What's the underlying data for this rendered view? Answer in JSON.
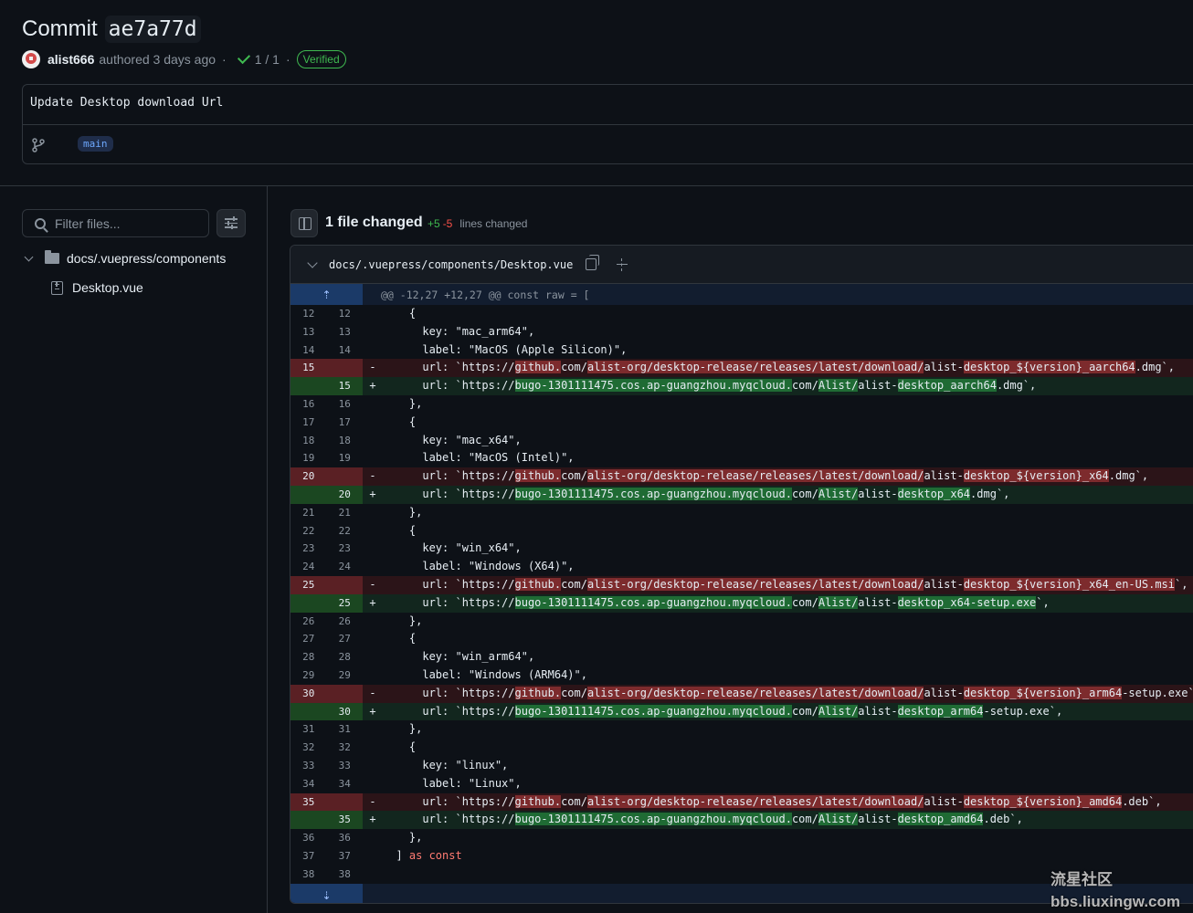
{
  "commit": {
    "word": "Commit",
    "sha": "ae7a77d",
    "author": "alist666",
    "authored": "authored 3 days ago",
    "sep": "·",
    "checks": "1 / 1",
    "verified": "Verified",
    "message": "Update Desktop download Url",
    "branch": "main"
  },
  "sidebar": {
    "filter_placeholder": "Filter files...",
    "folder": "docs/.vuepress/components",
    "file": "Desktop.vue"
  },
  "summary": {
    "files_changed": "1 file changed",
    "additions": "+5",
    "deletions": "-5",
    "lines_changed": "lines changed"
  },
  "file_header": {
    "path": "docs/.vuepress/components/Desktop.vue"
  },
  "hunk_header": "@@ -12,27 +12,27 @@ const raw = [",
  "diff_lines": [
    {
      "type": "ctx",
      "old": "12",
      "new": "12",
      "code": "    {"
    },
    {
      "type": "ctx",
      "old": "13",
      "new": "13",
      "code": "      key: \"mac_arm64\","
    },
    {
      "type": "ctx",
      "old": "14",
      "new": "14",
      "code": "      label: \"MacOS (Apple Silicon)\","
    },
    {
      "type": "del",
      "old": "15",
      "new": "",
      "parts": [
        "      url: `https://",
        "!github.",
        "com/",
        "!alist-org/desktop-release/releases/latest/download/",
        "alist-",
        "!desktop_${version}_aarch64",
        ".dmg`,"
      ]
    },
    {
      "type": "add",
      "old": "",
      "new": "15",
      "parts": [
        "      url: `https://",
        "!bugo-1301111475.cos.ap-guangzhou.myqcloud.",
        "com/",
        "!Alist/",
        "alist-",
        "!desktop_aarch64",
        ".dmg`,"
      ]
    },
    {
      "type": "ctx",
      "old": "16",
      "new": "16",
      "code": "    },"
    },
    {
      "type": "ctx",
      "old": "17",
      "new": "17",
      "code": "    {"
    },
    {
      "type": "ctx",
      "old": "18",
      "new": "18",
      "code": "      key: \"mac_x64\","
    },
    {
      "type": "ctx",
      "old": "19",
      "new": "19",
      "code": "      label: \"MacOS (Intel)\","
    },
    {
      "type": "del",
      "old": "20",
      "new": "",
      "parts": [
        "      url: `https://",
        "!github.",
        "com/",
        "!alist-org/desktop-release/releases/latest/download/",
        "alist-",
        "!desktop_${version}_x64",
        ".dmg`,"
      ]
    },
    {
      "type": "add",
      "old": "",
      "new": "20",
      "parts": [
        "      url: `https://",
        "!bugo-1301111475.cos.ap-guangzhou.myqcloud.",
        "com/",
        "!Alist/",
        "alist-",
        "!desktop_x64",
        ".dmg`,"
      ]
    },
    {
      "type": "ctx",
      "old": "21",
      "new": "21",
      "code": "    },"
    },
    {
      "type": "ctx",
      "old": "22",
      "new": "22",
      "code": "    {"
    },
    {
      "type": "ctx",
      "old": "23",
      "new": "23",
      "code": "      key: \"win_x64\","
    },
    {
      "type": "ctx",
      "old": "24",
      "new": "24",
      "code": "      label: \"Windows (X64)\","
    },
    {
      "type": "del",
      "old": "25",
      "new": "",
      "parts": [
        "      url: `https://",
        "!github.",
        "com/",
        "!alist-org/desktop-release/releases/latest/download/",
        "alist-",
        "!desktop_${version}_x64_en-US.msi",
        "`,"
      ]
    },
    {
      "type": "add",
      "old": "",
      "new": "25",
      "parts": [
        "      url: `https://",
        "!bugo-1301111475.cos.ap-guangzhou.myqcloud.",
        "com/",
        "!Alist/",
        "alist-",
        "!desktop_x64-setup.exe",
        "`,"
      ]
    },
    {
      "type": "ctx",
      "old": "26",
      "new": "26",
      "code": "    },"
    },
    {
      "type": "ctx",
      "old": "27",
      "new": "27",
      "code": "    {"
    },
    {
      "type": "ctx",
      "old": "28",
      "new": "28",
      "code": "      key: \"win_arm64\","
    },
    {
      "type": "ctx",
      "old": "29",
      "new": "29",
      "code": "      label: \"Windows (ARM64)\","
    },
    {
      "type": "del",
      "old": "30",
      "new": "",
      "parts": [
        "      url: `https://",
        "!github.",
        "com/",
        "!alist-org/desktop-release/releases/latest/download/",
        "alist-",
        "!desktop_${version}_arm64",
        "-setup.exe`,"
      ]
    },
    {
      "type": "add",
      "old": "",
      "new": "30",
      "parts": [
        "      url: `https://",
        "!bugo-1301111475.cos.ap-guangzhou.myqcloud.",
        "com/",
        "!Alist/",
        "alist-",
        "!desktop_arm64",
        "-setup.exe`,"
      ]
    },
    {
      "type": "ctx",
      "old": "31",
      "new": "31",
      "code": "    },"
    },
    {
      "type": "ctx",
      "old": "32",
      "new": "32",
      "code": "    {"
    },
    {
      "type": "ctx",
      "old": "33",
      "new": "33",
      "code": "      key: \"linux\","
    },
    {
      "type": "ctx",
      "old": "34",
      "new": "34",
      "code": "      label: \"Linux\","
    },
    {
      "type": "del",
      "old": "35",
      "new": "",
      "parts": [
        "      url: `https://",
        "!github.",
        "com/",
        "!alist-org/desktop-release/releases/latest/download/",
        "alist-",
        "!desktop_${version}_amd64",
        ".deb`,"
      ]
    },
    {
      "type": "add",
      "old": "",
      "new": "35",
      "parts": [
        "      url: `https://",
        "!bugo-1301111475.cos.ap-guangzhou.myqcloud.",
        "com/",
        "!Alist/",
        "alist-",
        "!desktop_amd64",
        ".deb`,"
      ]
    },
    {
      "type": "ctx",
      "old": "36",
      "new": "36",
      "code": "    },"
    },
    {
      "type": "ctx",
      "old": "37",
      "new": "37",
      "code": "  ] ",
      "kw": "as const"
    },
    {
      "type": "ctx",
      "old": "38",
      "new": "38",
      "code": ""
    }
  ],
  "watermark": {
    "line1": "流星社区",
    "line2": "bbs.liuxingw.com"
  }
}
